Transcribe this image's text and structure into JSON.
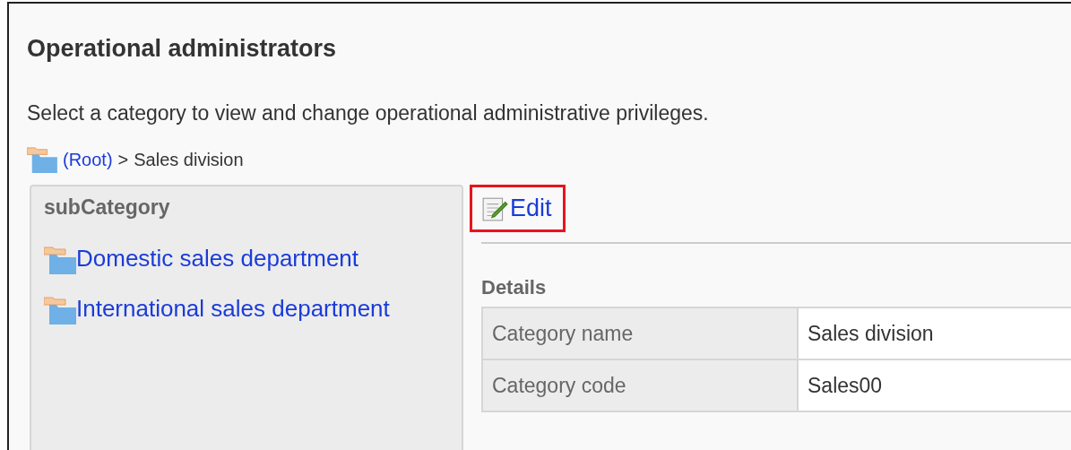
{
  "title": "Operational administrators",
  "description": "Select a category to view and change operational administrative privileges.",
  "breadcrumb": [
    {
      "label": "(Root)",
      "kind": "link"
    },
    {
      "label": ">",
      "kind": "separator"
    },
    {
      "label": "Sales division",
      "kind": "current"
    }
  ],
  "subcategory_panel": {
    "heading": "subCategory",
    "items": [
      {
        "label": "Domestic sales department"
      },
      {
        "label": "International sales department"
      }
    ]
  },
  "edit_link": {
    "label": "Edit",
    "highlighted": true
  },
  "details": {
    "heading": "Details",
    "rows": [
      {
        "label": "Category name",
        "value": "Sales division"
      },
      {
        "label": "Category code",
        "value": "Sales00"
      }
    ]
  }
}
